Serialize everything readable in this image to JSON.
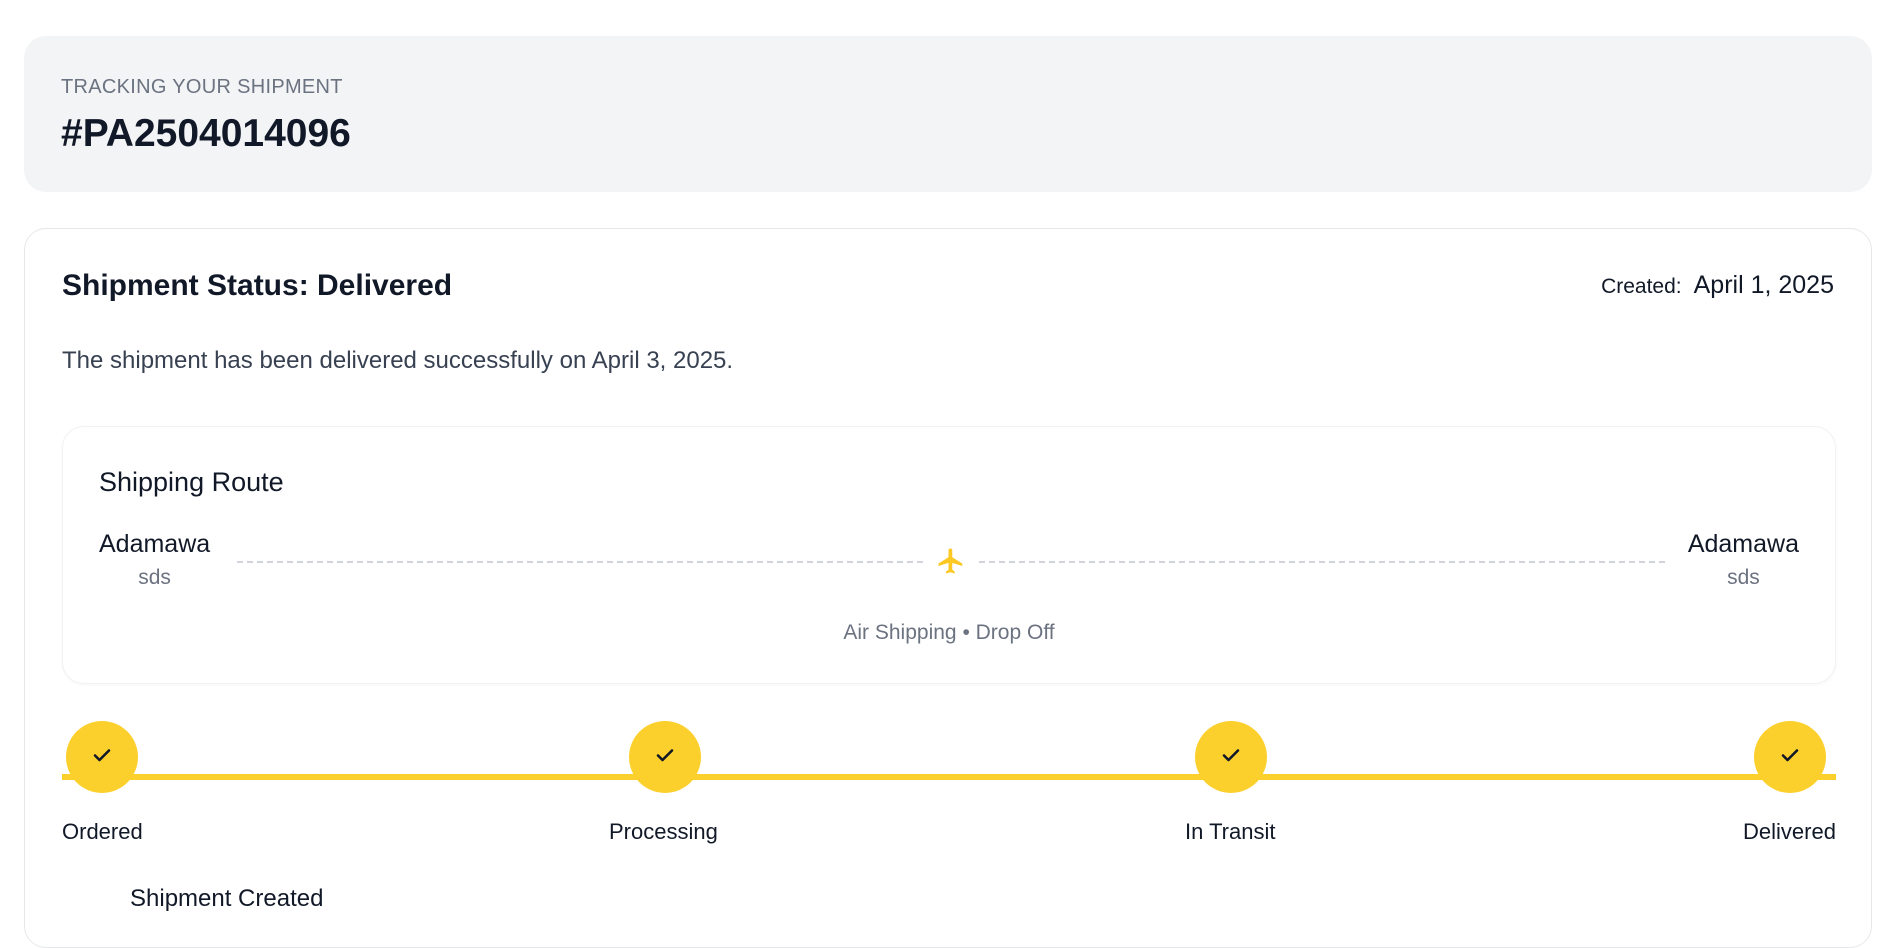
{
  "header": {
    "label": "TRACKING YOUR SHIPMENT",
    "tracking_id": "#PA2504014096"
  },
  "status": {
    "title": "Shipment Status: Delivered",
    "created_label": "Created:",
    "created_date": "April 1, 2025",
    "description": "The shipment has been delivered successfully on April 3, 2025."
  },
  "route": {
    "title": "Shipping Route",
    "origin": {
      "name": "Adamawa",
      "sub": "sds"
    },
    "destination": {
      "name": "Adamawa",
      "sub": "sds"
    },
    "method": "Air Shipping • Drop Off",
    "icon": "airplane-icon",
    "accent_color": "#fcc823"
  },
  "progress": {
    "accent_color": "#fcd02c",
    "steps": [
      {
        "label": "Ordered",
        "complete": true
      },
      {
        "label": "Processing",
        "complete": true
      },
      {
        "label": "In Transit",
        "complete": true
      },
      {
        "label": "Delivered",
        "complete": true
      }
    ]
  },
  "next_section": {
    "heading": "Shipment Created"
  }
}
